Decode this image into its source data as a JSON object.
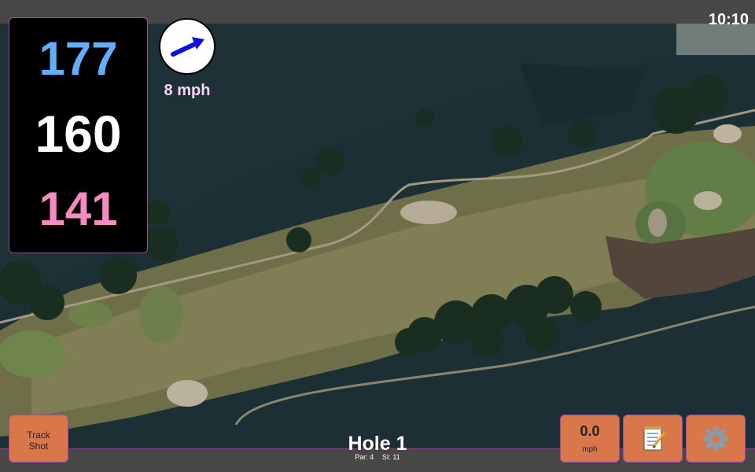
{
  "status": {
    "time": "10:10"
  },
  "yardage": {
    "back": "177",
    "middle": "160",
    "front": "141"
  },
  "wind": {
    "speed": "8 mph",
    "direction_icon": "wind-arrow-icon"
  },
  "hole": {
    "title": "Hole 1",
    "par": "Par: 4",
    "stroke_index": "SI: 11"
  },
  "buttons": {
    "track_shot": [
      "Track",
      "Shot"
    ],
    "speed_value": "0.0",
    "speed_unit": "mph",
    "notes_icon": "notepad-icon",
    "settings_icon": "gear-icon"
  },
  "colors": {
    "back_yardage": "#64aef8",
    "middle_yardage": "#ffffff",
    "front_yardage": "#f68ac2",
    "button_bg": "#d9774b",
    "accent_border": "#9a4aa0"
  }
}
